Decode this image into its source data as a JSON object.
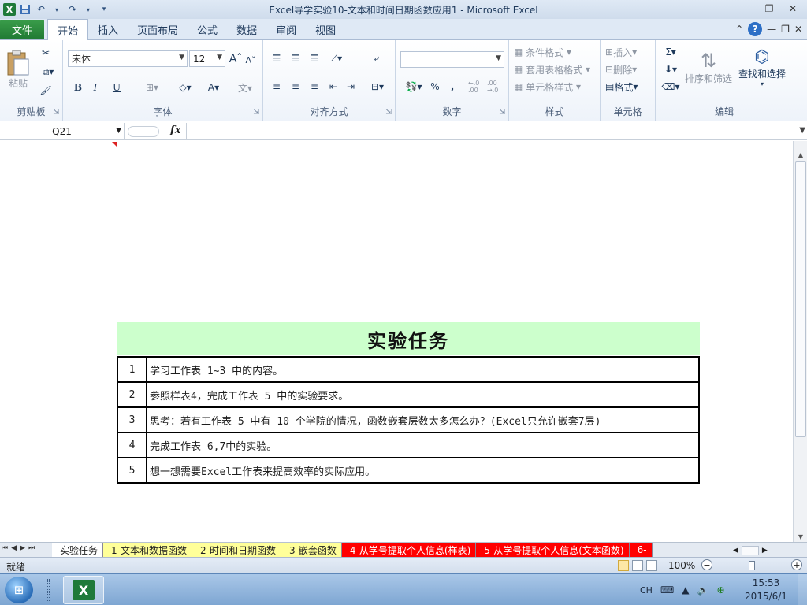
{
  "window": {
    "title": "Excel导学实验10-文本和时间日期函数应用1  -  Microsoft Excel",
    "app_icon": "excel-icon"
  },
  "qat": {
    "save": "save-icon",
    "undo": "undo-icon",
    "redo": "redo-icon"
  },
  "ribbon_tabs": {
    "file": "文件",
    "home": "开始",
    "insert": "插入",
    "layout": "页面布局",
    "formulas": "公式",
    "data": "数据",
    "review": "审阅",
    "view": "视图"
  },
  "ribbon": {
    "clipboard": {
      "label": "剪贴板",
      "paste": "粘贴"
    },
    "font": {
      "label": "字体",
      "font_name": "宋体",
      "font_size": "12",
      "bold": "B",
      "italic": "I",
      "underline": "U",
      "grow": "A",
      "shrink": "A"
    },
    "alignment": {
      "label": "对齐方式"
    },
    "number": {
      "label": "数字",
      "format": "",
      "percent": "%",
      "comma": ",",
      "inc_decimal": "←.0 .00",
      "dec_decimal": ".00 →.0"
    },
    "styles": {
      "label": "样式",
      "conditional": "条件格式",
      "table_format": "套用表格格式",
      "cell_styles": "单元格样式"
    },
    "cells": {
      "label": "单元格",
      "insert": "插入",
      "delete": "删除",
      "format": "格式"
    },
    "editing": {
      "label": "编辑",
      "sigma": "Σ",
      "sort": "排序和筛选",
      "find": "查找和选择"
    }
  },
  "formula_bar": {
    "name_box": "Q21",
    "fx": "fx",
    "value": ""
  },
  "sheet": {
    "task_title": "实验任务",
    "tasks": [
      {
        "num": "1",
        "text": "学习工作表 1~3 中的内容。"
      },
      {
        "num": "2",
        "text": "参照样表4，完成工作表 5 中的实验要求。"
      },
      {
        "num": "3",
        "text": "思考：若有工作表 5 中有 10 个学院的情况，函数嵌套层数太多怎么办？(Excel只允许嵌套7层)"
      },
      {
        "num": "4",
        "text": "完成工作表 6,7中的实验。"
      },
      {
        "num": "5",
        "text": "想一想需要Excel工作表来提高效率的实际应用。"
      }
    ]
  },
  "sheet_tabs": [
    {
      "label": "实验任务",
      "style": "active"
    },
    {
      "label": "1-文本和数据函数",
      "style": "yellow"
    },
    {
      "label": "2-时间和日期函数",
      "style": "yellow"
    },
    {
      "label": "3-嵌套函数",
      "style": "yellow"
    },
    {
      "label": "4-从学号提取个人信息(样表)",
      "style": "red"
    },
    {
      "label": "5-从学号提取个人信息(文本函数)",
      "style": "red"
    },
    {
      "label": "6-",
      "style": "red"
    }
  ],
  "status": {
    "ready": "就绪",
    "zoom": "100%"
  },
  "taskbar": {
    "lang": "CH",
    "time": "15:53",
    "date": "2015/6/1"
  },
  "colors": {
    "file_tab": "#217a35",
    "task_header_bg": "#ccffcc",
    "tab_yellow": "#ffff99",
    "tab_red": "#ff0000"
  }
}
